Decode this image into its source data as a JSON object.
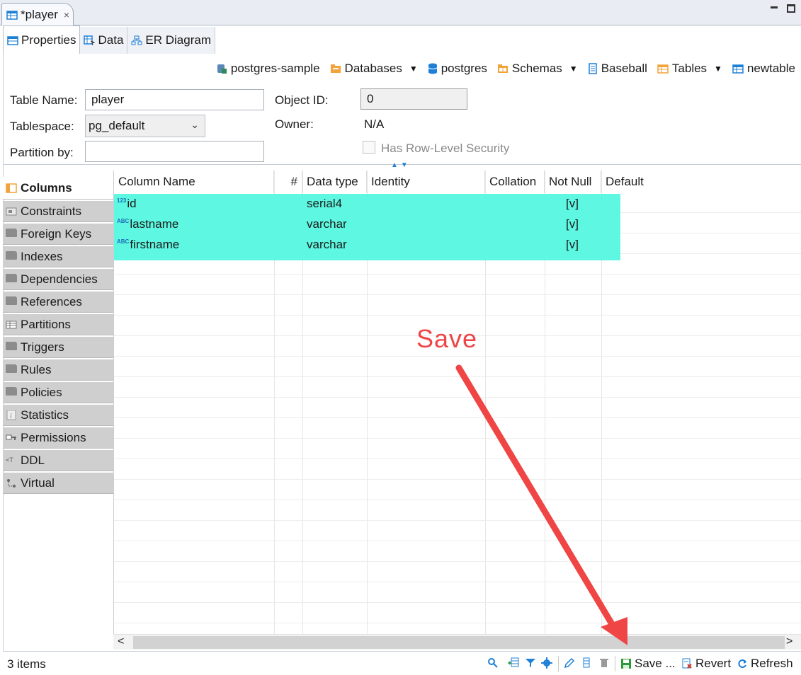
{
  "editor_tab": {
    "title": "*player",
    "close": "×"
  },
  "subtabs": [
    {
      "label": "Properties"
    },
    {
      "label": "Data"
    },
    {
      "label": "ER Diagram"
    }
  ],
  "breadcrumb": {
    "connection": "postgres-sample",
    "databases": "Databases",
    "database": "postgres",
    "schemas": "Schemas",
    "schema": "Baseball",
    "tables": "Tables",
    "table": "newtable"
  },
  "form": {
    "table_name_label": "Table Name:",
    "table_name_value": "player",
    "tablespace_label": "Tablespace:",
    "tablespace_value": "pg_default",
    "partition_label": "Partition by:",
    "partition_value": "",
    "object_id_label": "Object ID:",
    "object_id_value": "0",
    "owner_label": "Owner:",
    "owner_value": "N/A",
    "rls_label": "Has Row-Level Security"
  },
  "nav": [
    {
      "label": "Columns",
      "icon": "columns-icon"
    },
    {
      "label": "Constraints",
      "icon": "constraints-icon"
    },
    {
      "label": "Foreign Keys",
      "icon": "folder-icon"
    },
    {
      "label": "Indexes",
      "icon": "folder-icon"
    },
    {
      "label": "Dependencies",
      "icon": "folder-icon"
    },
    {
      "label": "References",
      "icon": "folder-icon"
    },
    {
      "label": "Partitions",
      "icon": "table-icon"
    },
    {
      "label": "Triggers",
      "icon": "folder-icon"
    },
    {
      "label": "Rules",
      "icon": "folder-icon"
    },
    {
      "label": "Policies",
      "icon": "folder-icon"
    },
    {
      "label": "Statistics",
      "icon": "info-icon"
    },
    {
      "label": "Permissions",
      "icon": "key-icon"
    },
    {
      "label": "DDL",
      "icon": "ddl-icon"
    },
    {
      "label": "Virtual",
      "icon": "virtual-icon"
    }
  ],
  "grid": {
    "headers": [
      "Column Name",
      "#",
      "Data type",
      "Identity",
      "Collation",
      "Not Null",
      "Default"
    ],
    "rows": [
      {
        "type_badge": "123",
        "name": "id",
        "data_type": "serial4",
        "not_null": "[v]"
      },
      {
        "type_badge": "ABC",
        "name": "lastname",
        "data_type": "varchar",
        "not_null": "[v]"
      },
      {
        "type_badge": "ABC",
        "name": "firstname",
        "data_type": "varchar",
        "not_null": "[v]"
      }
    ]
  },
  "annotation": {
    "text": "Save",
    "color": "#ef4545"
  },
  "statusbar": {
    "items_count": "3 items",
    "save_label": "Save ...",
    "revert_label": "Revert",
    "refresh_label": "Refresh"
  },
  "colors": {
    "highlight": "#55f7df",
    "accent": "#1e7fd6"
  }
}
